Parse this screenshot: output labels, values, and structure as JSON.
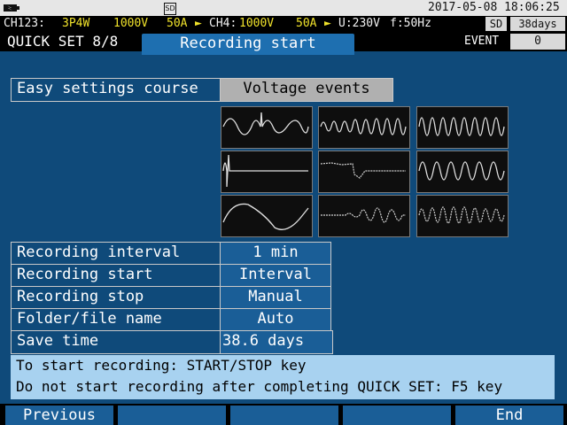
{
  "status": {
    "datetime": "2017-05-08 18:06:25",
    "sd_card_label": "SD"
  },
  "channels": {
    "ch123_label": "CH123:",
    "ch123_wiring": "3P4W",
    "ch123_voltage": "1000V",
    "ch123_current": "50A",
    "ch4_label": "CH4:",
    "ch4_voltage": "1000V",
    "ch4_current": "50A",
    "u": "U:230V",
    "f": "f:50Hz",
    "sd_label": "SD",
    "remaining_days": "38days"
  },
  "header": {
    "quick_set": "QUICK SET 8/8",
    "tab_title": "Recording start",
    "event_label": "EVENT",
    "event_count": "0"
  },
  "easy": {
    "label": "Easy settings course",
    "value": "Voltage events"
  },
  "settings": [
    {
      "label": "Recording interval",
      "value": "1 min"
    },
    {
      "label": "Recording start",
      "value": "Interval"
    },
    {
      "label": "Recording stop",
      "value": "Manual"
    },
    {
      "label": "Folder/file name",
      "value": "Auto"
    },
    {
      "label": "Save time",
      "value": "38.6 days"
    }
  ],
  "info": {
    "line1": "To start recording: START/STOP key",
    "line2": "Do not start recording after completing QUICK SET: F5 key"
  },
  "fkeys": [
    "Previous",
    "",
    "",
    "",
    "End"
  ],
  "colors": {
    "background": "#0f4a7a",
    "highlight": "#1e6fb0",
    "info_box": "#a8d2f0",
    "yellow": "#f0e22b"
  },
  "icons": [
    "battery-icon",
    "sd-card-icon",
    "clamp-sensor-icon"
  ]
}
